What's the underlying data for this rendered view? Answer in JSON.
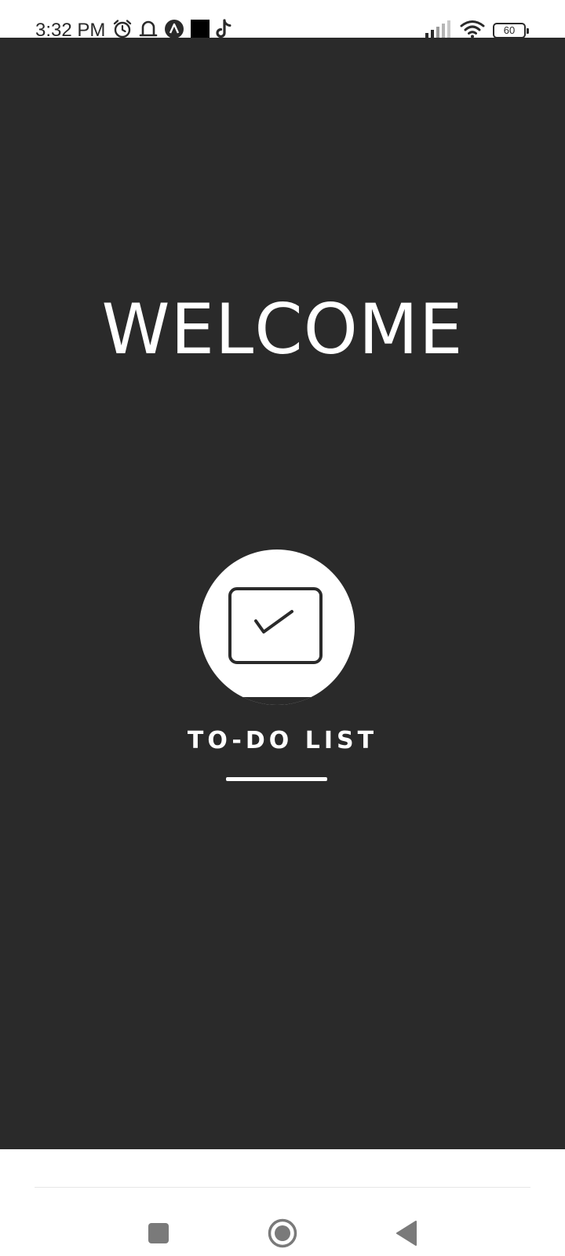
{
  "status_bar": {
    "time": "3:32 PM",
    "left_icons": [
      "alarm-icon",
      "notification-bell-icon",
      "app-a-icon",
      "black-square-icon",
      "tiktok-icon"
    ],
    "right_icons": [
      "signal-icon",
      "wifi-icon",
      "battery-icon"
    ],
    "battery_level": "60"
  },
  "main": {
    "welcome_text": "WELCOME",
    "app_name": "TO-DO LIST",
    "logo_icon": "checkbox-check-icon",
    "background_color": "#2a2a2a",
    "foreground_color": "#ffffff"
  },
  "nav_bar": {
    "buttons": [
      "recents-square-icon",
      "home-circle-icon",
      "back-triangle-icon"
    ]
  }
}
